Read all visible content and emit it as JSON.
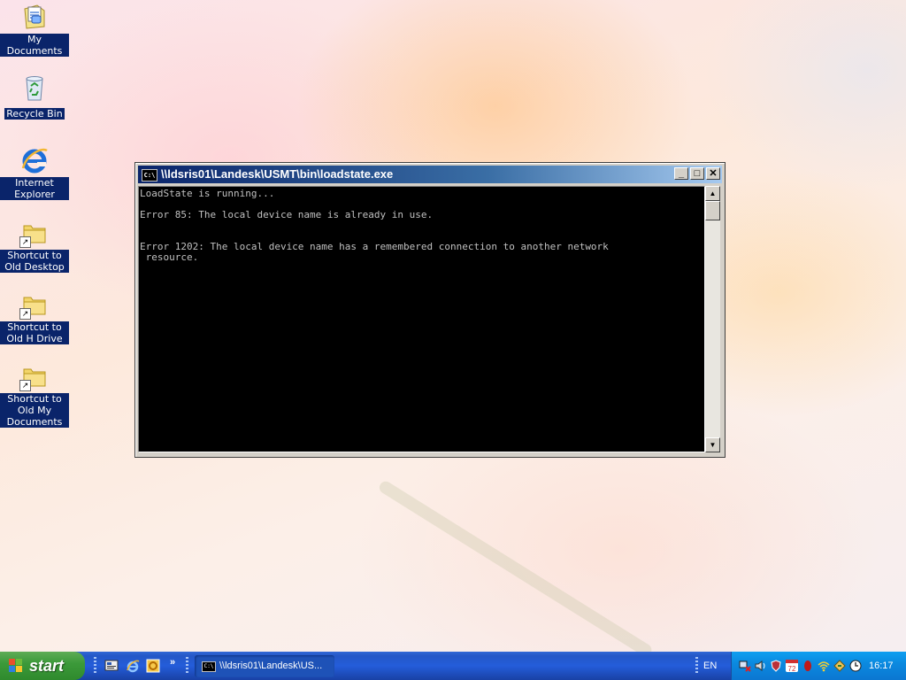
{
  "desktop": {
    "icons": [
      {
        "label": "My Documents",
        "icon": "my-documents-icon"
      },
      {
        "label": "Recycle Bin",
        "icon": "recycle-bin-icon"
      },
      {
        "label": "Internet Explorer",
        "icon": "internet-explorer-icon"
      },
      {
        "label": "Shortcut to Old Desktop",
        "icon": "folder-shortcut-icon"
      },
      {
        "label": "Shortcut to Old H Drive",
        "icon": "folder-shortcut-icon"
      },
      {
        "label": "Shortcut to Old My Documents",
        "icon": "folder-shortcut-icon"
      }
    ]
  },
  "console": {
    "title": "\\\\ldsris01\\Landesk\\USMT\\bin\\loadstate.exe",
    "system_icon_text": "C:\\",
    "lines": [
      "LoadState is running...",
      "",
      "Error 85: The local device name is already in use.",
      "",
      "",
      "Error 1202: The local device name has a remembered connection to another network",
      " resource."
    ]
  },
  "taskbar": {
    "start_label": "start",
    "quick_launch": [
      "show-desktop-icon",
      "internet-explorer-icon",
      "outlook-icon"
    ],
    "quick_launch_chevron": "»",
    "task_label": "\\\\ldsris01\\Landesk\\US...",
    "language": "EN",
    "clock": "16:17",
    "tray_icons": [
      "network-disconnected-icon",
      "volume-icon",
      "security-shield-icon",
      "calendar-icon",
      "antivirus-icon",
      "wireless-icon",
      "safely-remove-icon",
      "clock-tray-icon"
    ],
    "colors": {
      "taskbar": "#245dda",
      "start": "#3c9a3a",
      "tray": "#0b8ae0"
    }
  }
}
